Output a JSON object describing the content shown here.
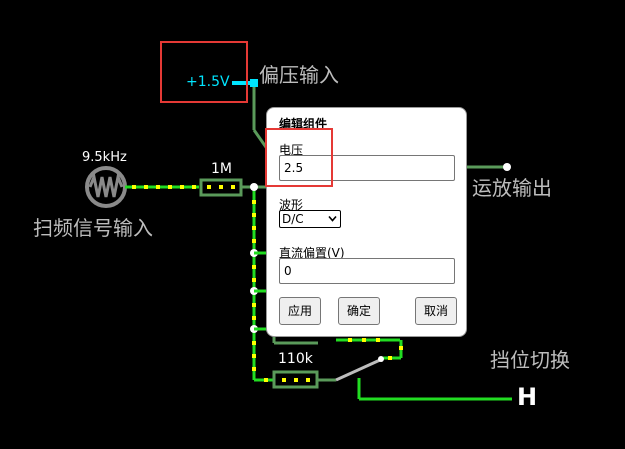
{
  "circuit": {
    "bias_source_label": "+1.5V",
    "bias_input_label": "偏压输入",
    "sweep_frequency_label": "9.5kHz",
    "sweep_input_label": "扫频信号输入",
    "resistor_1_label": "1M",
    "resistor_2_label": "110k",
    "opamp_output_label": "运放输出",
    "range_switch_label": "挡位切换",
    "switch_position_label": "H"
  },
  "dialog": {
    "title": "编辑组件",
    "voltage_label": "电压",
    "voltage_value": "2.5",
    "waveform_label": "波形",
    "waveform_selected": "D/C",
    "dc_offset_label": "直流偏置(V)",
    "dc_offset_value": "0",
    "apply_label": "应用",
    "ok_label": "确定",
    "cancel_label": "取消"
  },
  "colors": {
    "background": "#000000",
    "wire_active": "#22dd22",
    "wire_component": "#5a9a5a",
    "bias_wire": "#00ffff",
    "current_dot": "#ffff00",
    "highlight_box": "#e53935"
  }
}
